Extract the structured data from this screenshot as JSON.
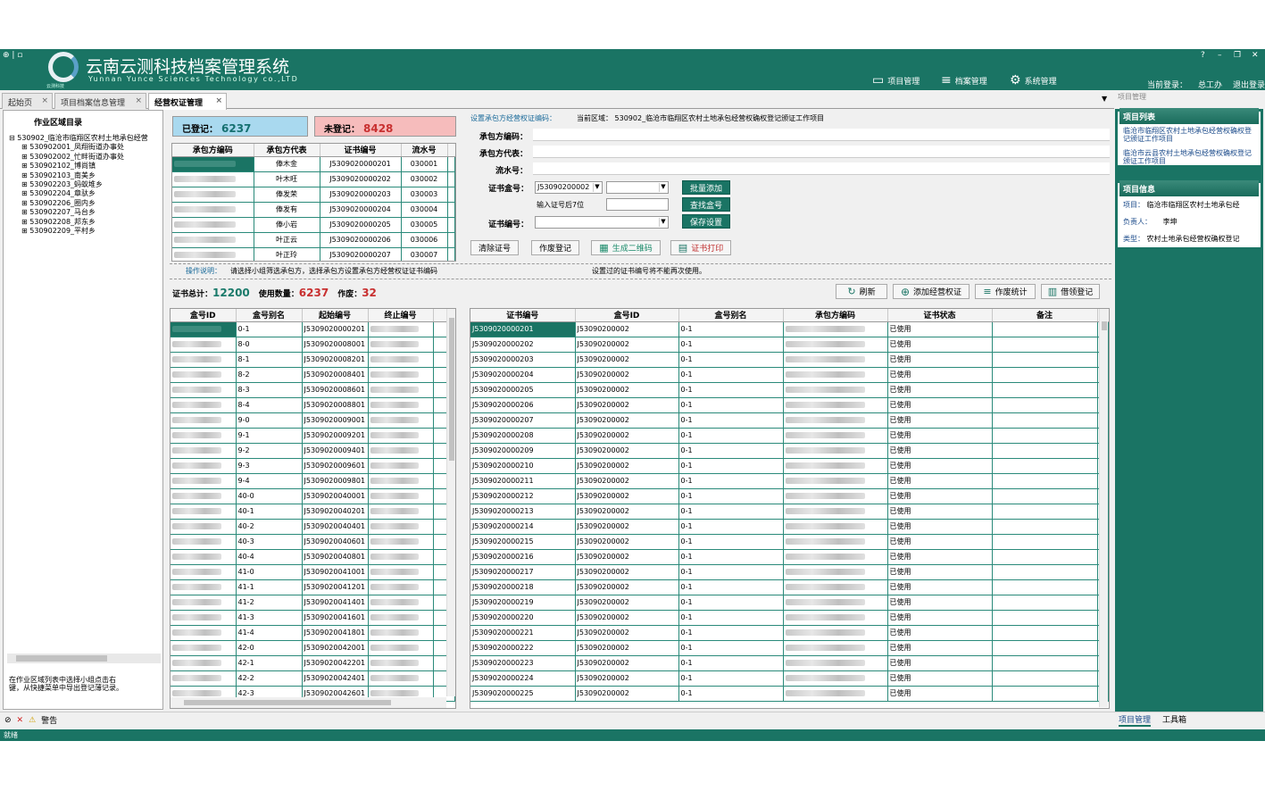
{
  "app": {
    "title": "云南云测科技档案管理系统",
    "subtitle": "Yunnan Yunce Sciences Technology co.,LTD",
    "logo_text": "云测科技"
  },
  "window": {
    "help": "?",
    "minimize": "–",
    "restore": "❐",
    "close": "✕"
  },
  "menu": [
    {
      "label": "项目管理",
      "icon": "monitor-icon"
    },
    {
      "label": "档案管理",
      "icon": "add-list-icon"
    },
    {
      "label": "系统管理",
      "icon": "settings-icon"
    }
  ],
  "user": {
    "current_login_label": "当前登录：",
    "name": "总工办",
    "logout": "退出登录"
  },
  "tabs": [
    "起始页",
    "项目档案信息管理",
    "经营权证管理"
  ],
  "tab_close": "×",
  "right_panel_title": "项目管理",
  "tree": {
    "title": "作业区域目录",
    "root": "530902_临沧市临翔区农村土地承包经营",
    "children": [
      "530902001_凤翔街道办事处",
      "530902002_忙畔街道办事处",
      "530902102_博尚镇",
      "530902103_南美乡",
      "530902203_蚂蚁堆乡",
      "530902204_章驮乡",
      "530902206_圈内乡",
      "530902207_马台乡",
      "530902208_邦东乡",
      "530902209_平村乡"
    ]
  },
  "left_hint": "在作业区域列表中选择小组点击右键，从快捷菜单中导出登记薄记录。",
  "stats": {
    "registered_label": "已登记：",
    "registered": "6237",
    "unregistered_label": "未登记：",
    "unregistered": "8428"
  },
  "contractor_grid": {
    "columns": [
      "承包方编码",
      "承包方代表",
      "证书编号",
      "流水号"
    ],
    "rows": [
      [
        "",
        "俸木金",
        "J5309020000201",
        "030001"
      ],
      [
        "",
        "叶木旺",
        "J5309020000202",
        "030002"
      ],
      [
        "",
        "俸发荣",
        "J5309020000203",
        "030003"
      ],
      [
        "",
        "俸发有",
        "J5309020000204",
        "030004"
      ],
      [
        "",
        "俸小岩",
        "J5309020000205",
        "030005"
      ],
      [
        "",
        "叶正云",
        "J5309020000206",
        "030006"
      ],
      [
        "",
        "叶正玲",
        "J5309020000207",
        "030007"
      ]
    ]
  },
  "form": {
    "section_title": "设置承包方经营权证编码：",
    "current_area": "当前区域：  530902_临沧市临翔区农村土地承包经营权确权登记颁证工作项目",
    "contractor_code_label": "承包方编码：",
    "contractor_rep_label": "承包方代表：",
    "serial_label": "流水号：",
    "box_label": "证书盒号：",
    "box_value": "J53090200002",
    "last7_label": "输入证号后7位",
    "cert_no_label": "证书编号：",
    "batch_add": "批量添加",
    "find_box": "查找盒号",
    "save_settings": "保存设置",
    "clear_no": "清除证号",
    "void_register": "作废登记",
    "gen_qr": "生成二维码",
    "print_cert": "证书打印"
  },
  "instructions": {
    "label": "操作说明：",
    "text1": "请选择小组筛选承包方，选择承包方设置承包方经营权证证书编码",
    "text2": "设置过的证书编号将不能再次使用。"
  },
  "totals": {
    "total_label": "证书总计：",
    "total": "12200",
    "used_label": "使用数量：",
    "used": "6237",
    "void_label": "作废：",
    "void": "32"
  },
  "actions": [
    "刷新",
    "添加经营权证",
    "作废统计",
    "借领登记"
  ],
  "box_grid": {
    "columns": [
      "盒号ID",
      "盒号别名",
      "起始编号",
      "终止编号"
    ],
    "rows": [
      [
        "",
        "0-1",
        "J5309020000201"
      ],
      [
        "",
        "8-0",
        "J5309020008001"
      ],
      [
        "",
        "8-1",
        "J5309020008201"
      ],
      [
        "",
        "8-2",
        "J5309020008401"
      ],
      [
        "",
        "8-3",
        "J5309020008601"
      ],
      [
        "",
        "8-4",
        "J5309020008801"
      ],
      [
        "",
        "9-0",
        "J5309020009001"
      ],
      [
        "",
        "9-1",
        "J5309020009201"
      ],
      [
        "",
        "9-2",
        "J5309020009401"
      ],
      [
        "",
        "9-3",
        "J5309020009601"
      ],
      [
        "",
        "9-4",
        "J5309020009801"
      ],
      [
        "",
        "40-0",
        "J5309020040001"
      ],
      [
        "",
        "40-1",
        "J5309020040201"
      ],
      [
        "",
        "40-2",
        "J5309020040401"
      ],
      [
        "",
        "40-3",
        "J5309020040601"
      ],
      [
        "",
        "40-4",
        "J5309020040801"
      ],
      [
        "",
        "41-0",
        "J5309020041001"
      ],
      [
        "",
        "41-1",
        "J5309020041201"
      ],
      [
        "",
        "41-2",
        "J5309020041401"
      ],
      [
        "",
        "41-3",
        "J5309020041601"
      ],
      [
        "",
        "41-4",
        "J5309020041801"
      ],
      [
        "",
        "42-0",
        "J5309020042001"
      ],
      [
        "",
        "42-1",
        "J5309020042201"
      ],
      [
        "",
        "42-2",
        "J5309020042401"
      ],
      [
        "",
        "42-3",
        "J5309020042601"
      ]
    ]
  },
  "cert_grid": {
    "columns": [
      "证书编号",
      "盒号ID",
      "盒号别名",
      "承包方编码",
      "证书状态",
      "备注"
    ],
    "box_id": "J53090200002",
    "alias": "0-1",
    "status": "已使用",
    "cert_nos": [
      "J5309020000201",
      "J5309020000202",
      "J5309020000203",
      "J5309020000204",
      "J5309020000205",
      "J5309020000206",
      "J5309020000207",
      "J5309020000208",
      "J5309020000209",
      "J5309020000210",
      "J5309020000211",
      "J5309020000212",
      "J5309020000213",
      "J5309020000214",
      "J5309020000215",
      "J5309020000216",
      "J5309020000217",
      "J5309020000218",
      "J5309020000219",
      "J5309020000220",
      "J5309020000221",
      "J5309020000222",
      "J5309020000223",
      "J5309020000224",
      "J5309020000225"
    ]
  },
  "project_list": {
    "title": "项目列表",
    "items": [
      "临沧市临翔区农村土地承包经营权确权登记颁证工作项目",
      "临沧市云县农村土地承包经营权确权登记颁证工作项目"
    ]
  },
  "project_info": {
    "title": "项目信息",
    "project_label": "项目：",
    "project": "临沧市临翔区农村土地承包经",
    "lead_label": "负责人：",
    "lead": "李坤",
    "type_label": "类型：",
    "type": "农村土地承包经营权确权登记"
  },
  "bottom": {
    "warning": "警告",
    "tab1": "项目管理",
    "tab2": "工具箱"
  },
  "status": "就绪"
}
